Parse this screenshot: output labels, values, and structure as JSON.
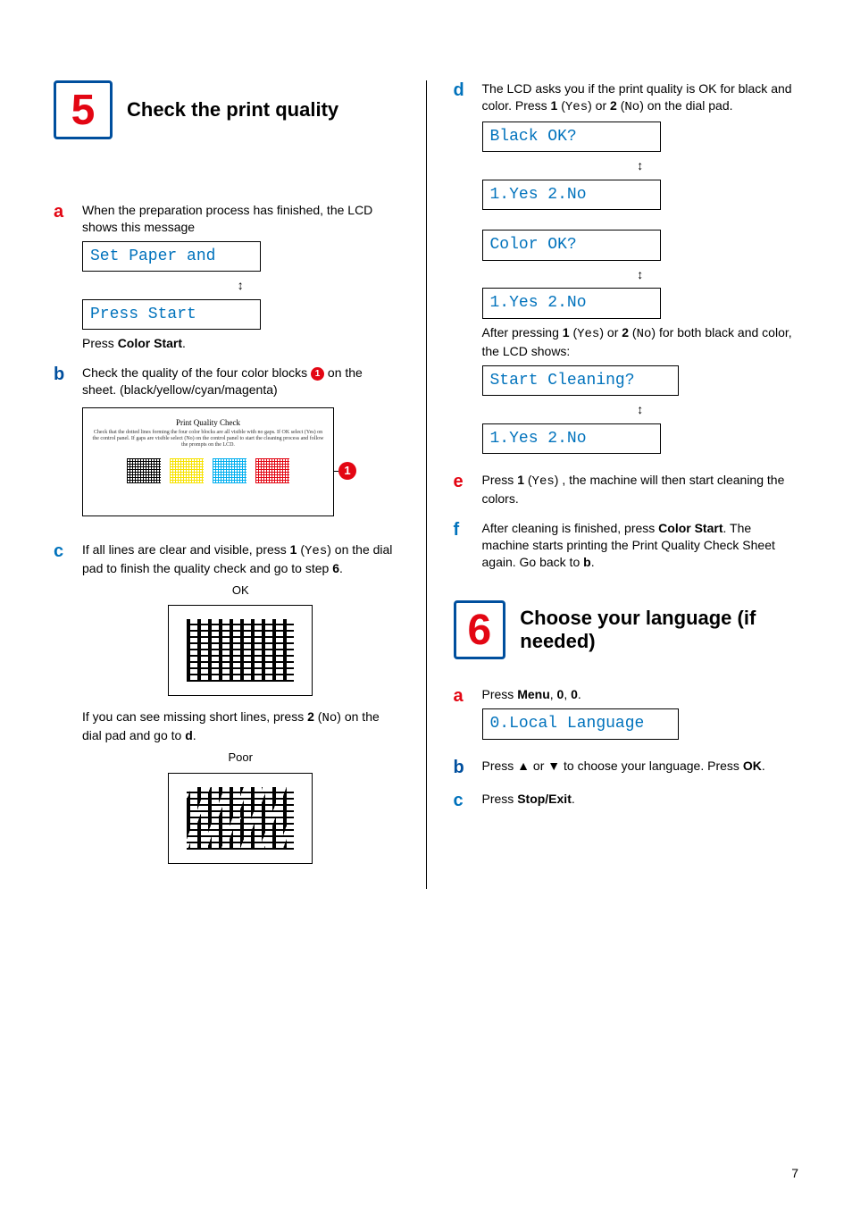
{
  "left": {
    "stepNum": "5",
    "stepTitle": "Check the print quality",
    "a": {
      "letter": "a",
      "text1": "When the preparation process has finished, the LCD shows this message",
      "lcd1": "Set Paper and",
      "arrows": "↕",
      "lcd2": "Press Start",
      "text2_pre": "Press ",
      "text2_bold": "Color Start",
      "text2_post": "."
    },
    "b": {
      "letter": "b",
      "text_pre": "Check the quality of the four color blocks ",
      "callout": "1",
      "text_post": " on the sheet. (black/yellow/cyan/magenta)",
      "sheetTitle": "Print Quality Check",
      "sheetSub": "Check that the dotted lines forming the four color blocks are all visible with no gaps. If OK select (Yes) on the control panel. If gaps are visible select (No) on the control panel to start the cleaning process and follow the prompts on the LCD."
    },
    "c": {
      "letter": "c",
      "text1_pre": "If all lines are clear and visible, press ",
      "text1_bold": "1",
      "text1_paren": "Yes",
      "text1_mid": " on the dial pad to finish the quality check and go to step ",
      "text1_step": "6",
      "text1_post": ".",
      "okLabel": "OK",
      "text2_pre": "If you can see missing short lines, press ",
      "text2_bold": "2",
      "text2_paren": "No",
      "text2_mid": " on the dial pad and go to ",
      "text2_step": "d",
      "text2_post": ".",
      "poorLabel": "Poor"
    }
  },
  "right": {
    "d": {
      "letter": "d",
      "text1_pre": "The LCD asks you if the print quality is OK for black and color. Press ",
      "b1": "1",
      "p1": "Yes",
      "mid1": " or ",
      "b2": "2",
      "p2": "No",
      "text1_post": " on the dial pad.",
      "lcd1": "Black OK?",
      "arrows": "↕",
      "lcd2": "1.Yes 2.No",
      "lcd3": "Color OK?",
      "lcd4": "1.Yes 2.No",
      "text2_pre": "After pressing ",
      "ab1": "1",
      "ap1": "Yes",
      "amid": "  or ",
      "ab2": "2",
      "ap2": "No",
      "text2_post": "  for both black and color, the LCD shows:",
      "lcd5": "Start Cleaning?",
      "lcd6": "1.Yes 2.No"
    },
    "e": {
      "letter": "e",
      "pre": "Press ",
      "b": "1",
      "p": "Yes",
      "post": " , the machine will then start cleaning the colors."
    },
    "f": {
      "letter": "f",
      "pre": "After cleaning is finished, press ",
      "b": "Color Start",
      "mid": ". The machine starts printing the Print Quality Check Sheet again. Go back to ",
      "ref": "b",
      "post": "."
    },
    "step6": {
      "num": "6",
      "title": "Choose your language (if needed)"
    },
    "s6a": {
      "letter": "a",
      "pre": "Press ",
      "b1": "Menu",
      "c1": ", ",
      "b2": "0",
      "c2": ", ",
      "b3": "0",
      "post": ".",
      "lcd": "0.Local Language"
    },
    "s6b": {
      "letter": "b",
      "pre": "Press ▲ or ▼ to choose your language. Press ",
      "b": "OK",
      "post": "."
    },
    "s6c": {
      "letter": "c",
      "pre": "Press ",
      "b": "Stop/Exit",
      "post": "."
    }
  },
  "pageNum": "7"
}
